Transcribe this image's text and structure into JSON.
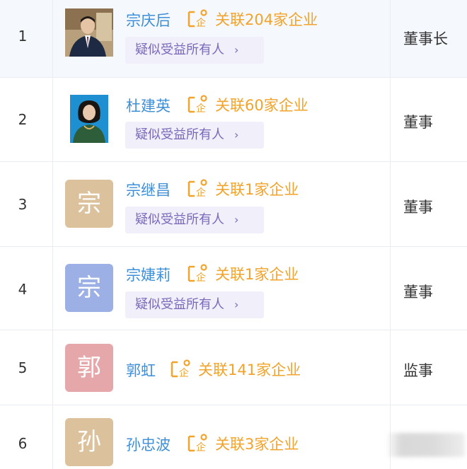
{
  "rows": [
    {
      "index": "1",
      "avatar_char": "",
      "avatar_color": "",
      "name": "宗庆后",
      "assoc": "关联204家企业",
      "tag": "疑似受益所有人",
      "role": "董事长"
    },
    {
      "index": "2",
      "avatar_char": "",
      "avatar_color": "",
      "name": "杜建英",
      "assoc": "关联60家企业",
      "tag": "疑似受益所有人",
      "role": "董事"
    },
    {
      "index": "3",
      "avatar_char": "宗",
      "avatar_color": "#dcc19d",
      "name": "宗继昌",
      "assoc": "关联1家企业",
      "tag": "疑似受益所有人",
      "role": "董事"
    },
    {
      "index": "4",
      "avatar_char": "宗",
      "avatar_color": "#9db0e6",
      "name": "宗婕莉",
      "assoc": "关联1家企业",
      "tag": "疑似受益所有人",
      "role": "董事"
    },
    {
      "index": "5",
      "avatar_char": "郭",
      "avatar_color": "#e6a7aa",
      "name": "郭虹",
      "assoc": "关联141家企业",
      "tag": "",
      "role": "监事"
    },
    {
      "index": "6",
      "avatar_char": "孙",
      "avatar_color": "#dcc19d",
      "name": "孙忠波",
      "assoc": "关联3家企业",
      "tag": "",
      "role": ""
    }
  ],
  "colors": {
    "name_link": "#3f8fd8",
    "assoc": "#f2a32b",
    "tag_bg": "#f1effa",
    "tag_text": "#7a68bb"
  },
  "icons": {
    "assoc_icon": "company-link-icon",
    "chevron": "chevron-right-icon"
  },
  "chevron_char": "›"
}
